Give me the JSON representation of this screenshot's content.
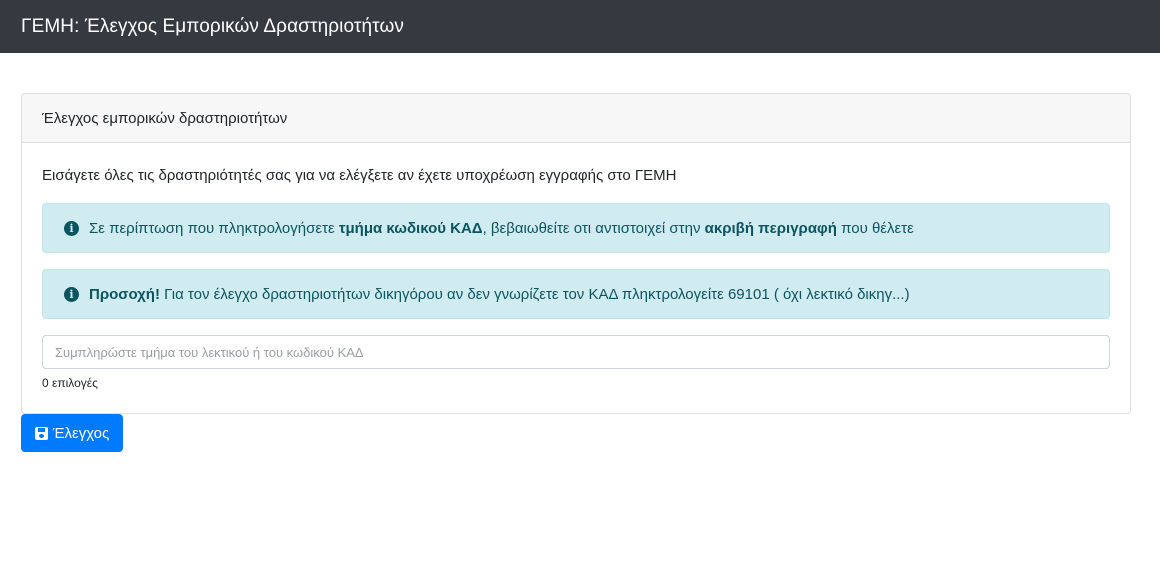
{
  "navbar": {
    "title": "ΓΕΜΗ: Έλεγχος Εμπορικών Δραστηριοτήτων"
  },
  "card": {
    "header": "Έλεγχος εμπορικών δραστηριοτήτων",
    "intro": "Εισάγετε όλες τις δραστηριότητές σας για να ελέγξετε αν έχετε υποχρέωση εγγραφής στο ΓΕΜΗ",
    "alerts": [
      {
        "icon": "info-circle-icon",
        "part1": "Σε περίπτωση που πληκτρολογήσετε ",
        "bold1": "τμήμα κωδικού ΚΑΔ",
        "part2": ", βεβαιωθείτε οτι αντιστοιχεί στην ",
        "bold2": "ακριβή περιγραφή",
        "part3": " που θέλετε"
      },
      {
        "icon": "info-circle-icon",
        "bold1": "Προσοχή!",
        "part1": " Για τον έλεγχο δραστηριοτήτων δικηγόρου αν δεν γνωρίζετε τον ΚΑΔ πληκτρολογείτε 69101 ( όχι λεκτικό δικηγ...)"
      }
    ],
    "search": {
      "value": "",
      "placeholder": "Συμπληρώστε τμήμα του λεκτικού ή του κωδικού ΚΑΔ"
    },
    "options_count": "0 επιλογές"
  },
  "submit": {
    "icon": "save-icon",
    "label": "Έλεγχος"
  },
  "colors": {
    "navbar_bg": "#343a40",
    "alert_bg": "#d1ecf1",
    "alert_text": "#0c5460",
    "primary": "#007bff"
  }
}
